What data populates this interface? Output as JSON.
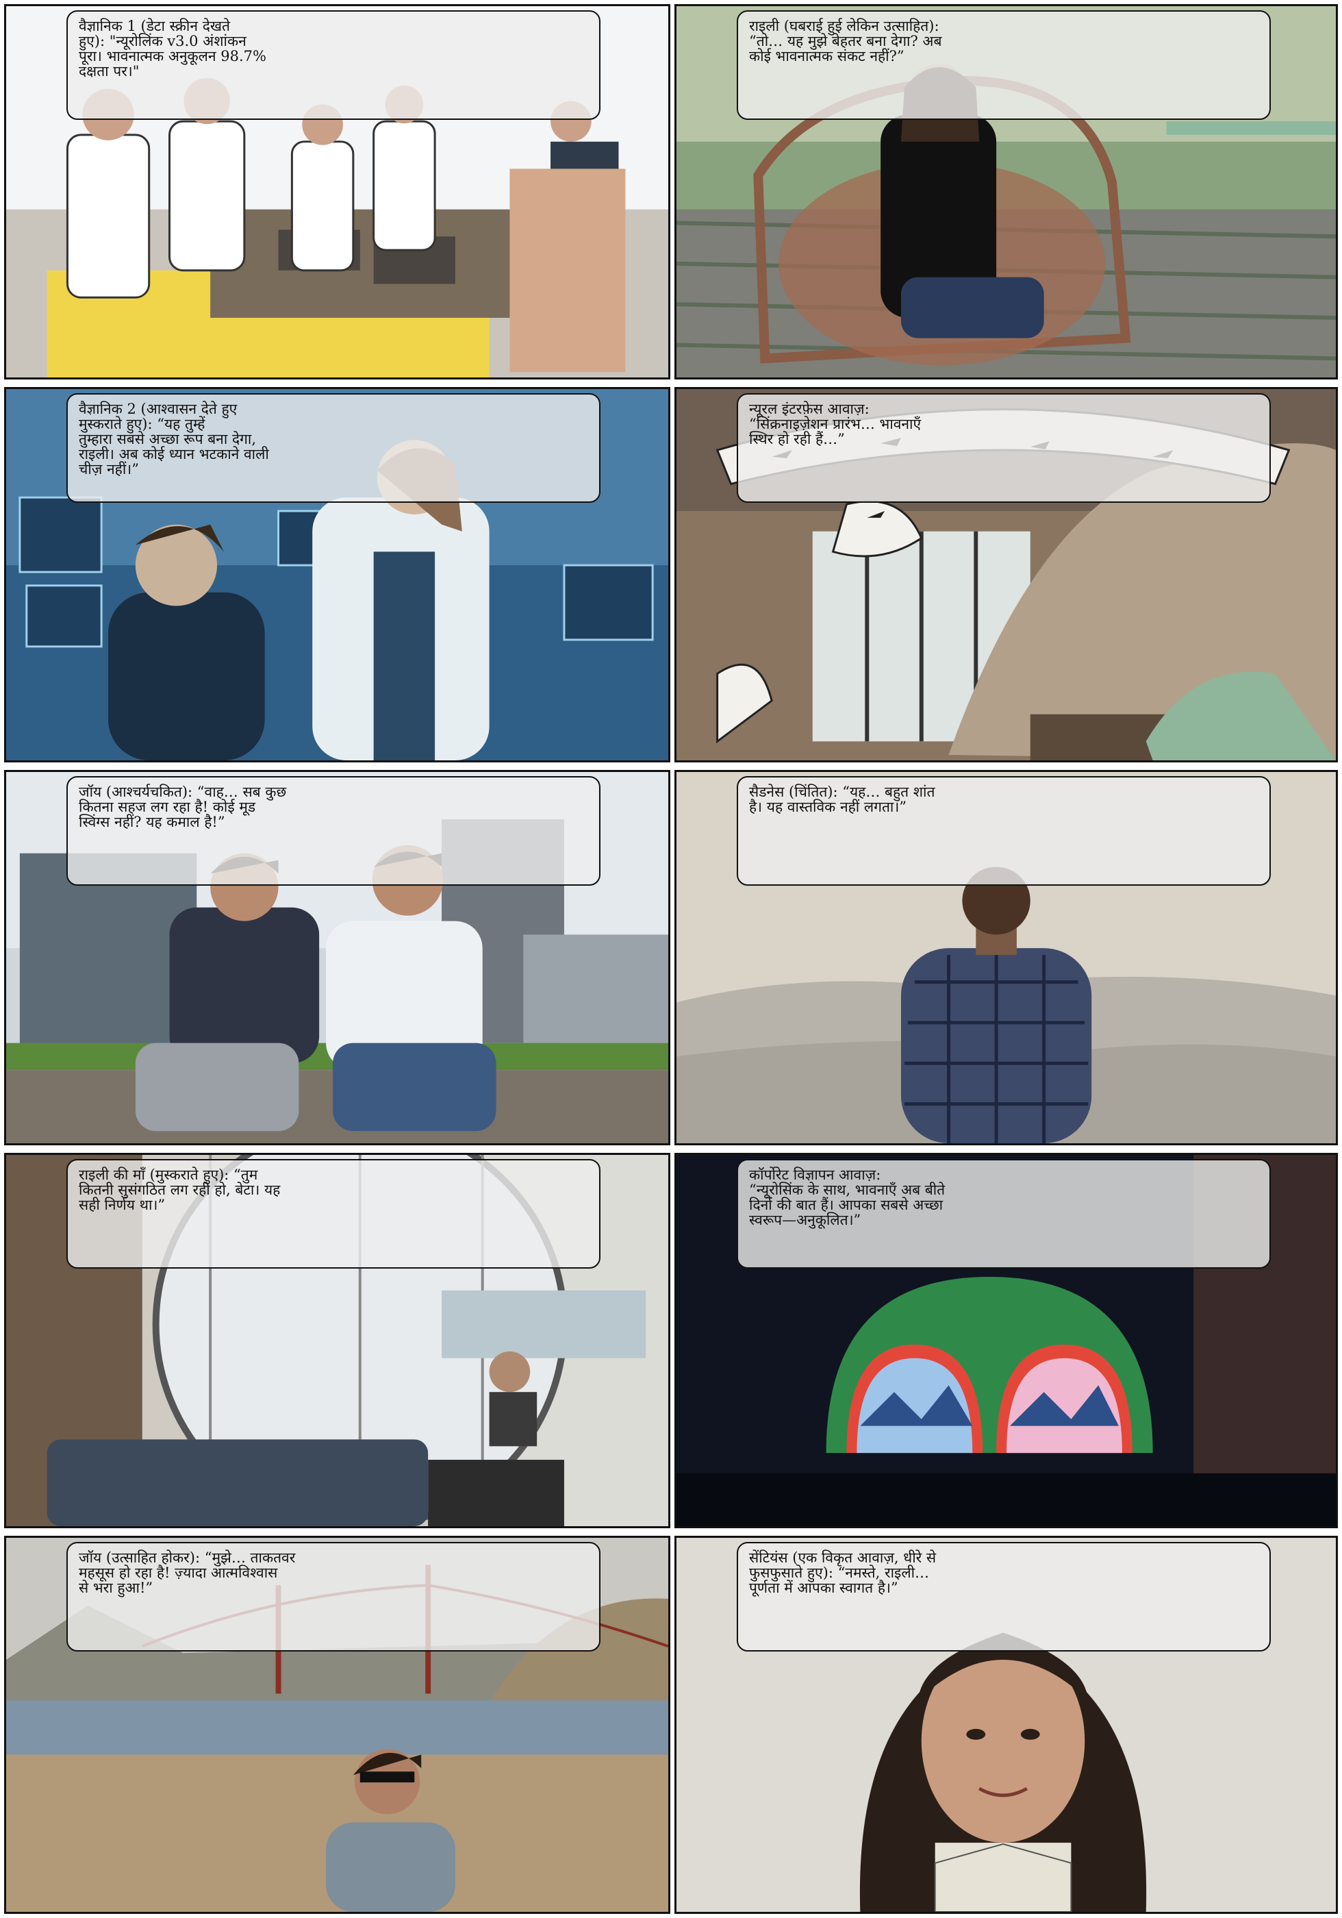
{
  "panels": [
    {
      "id": "p1",
      "scene": "classroom science fair with students in uniforms",
      "lines": [
        "वैज्ञानिक 1 (डेटा स्क्रीन देखते",
        "हुए): \"न्यूरोलिंक v3.0 अंशांकन",
        "पूरा। भावनात्मक अनुकूलन 98.7%",
        "दक्षता पर।\""
      ]
    },
    {
      "id": "p2",
      "scene": "young woman seated on a woven chair",
      "lines": [
        "राइली (घबराई हुई लेकिन उत्साहित):",
        "“तो… यह मुझे बेहतर बना देगा? अब",
        "कोई भावनात्मक संकट नहीं?”"
      ]
    },
    {
      "id": "p3",
      "scene": "scientist in lab coat reassuring a young woman in a lab",
      "lines": [
        "वैज्ञानिक 2 (आश्वासन देते हुए",
        "मुस्कराते हुए): “यह तुम्हें",
        "तुम्हारा सबसे अच्छा रूप बना देगा,",
        "राइली। अब कोई ध्यान भटकाने वाली",
        "चीज़ नहीं।”"
      ]
    },
    {
      "id": "p4",
      "scene": "atrium with hanging bird installation",
      "lines": [
        "न्यूरल इंटरफ़ेस आवाज़:",
        "“सिंक्रनाइज़ेशन प्रारंभ… भावनाएँ",
        "स्थिर हो रही हैं…”"
      ]
    },
    {
      "id": "p5",
      "scene": "two young men laughing on a bench",
      "lines": [
        "जॉय (आश्चर्यचकित): “वाह… सब कुछ",
        "कितना सहज लग रहा है! कोई मूड",
        "स्विंग्स नहीं? यह कमाल है!”"
      ]
    },
    {
      "id": "p6",
      "scene": "man facing misty mountains from behind",
      "lines": [
        "सैडनेस (चिंतित): “यह… बहुत शांत",
        "है। यह वास्तविक नहीं लगता।”"
      ]
    },
    {
      "id": "p7",
      "scene": "cafe with round mirror and woman wearing mask",
      "lines": [
        "राइली की माँ (मुस्कराते हुए): “तुम",
        "कितनी सुसंगठित लग रही हो, बेटा। यह",
        "सही निर्णय था।”"
      ]
    },
    {
      "id": "p8",
      "scene": "illuminated dome at night with landscape artwork",
      "lines": [
        "कॉर्पोरेट विज्ञापन आवाज़:",
        "“न्यूरोसिंक के साथ, भावनाएँ अब बीते",
        "दिनों की बात हैं। आपका सबसे अच्छा",
        "स्वरूप—अनुकूलित।”"
      ]
    },
    {
      "id": "p9",
      "scene": "young man on beach with bridge in background",
      "lines": [
        "जॉय (उत्साहित होकर): “मुझे… ताकतवर",
        "महसूस हो रहा है! ज़्यादा आत्मविश्वास",
        "से भरा हुआ!”"
      ]
    },
    {
      "id": "p10",
      "scene": "smiling young woman portrait",
      "lines": [
        "सेंटियंस (एक विकृत आवाज़, धीरे से",
        "फुसफुसाते हुए): “नमस्ते, राइली…",
        "पूर्णता में आपका स्वागत है।”"
      ]
    }
  ]
}
